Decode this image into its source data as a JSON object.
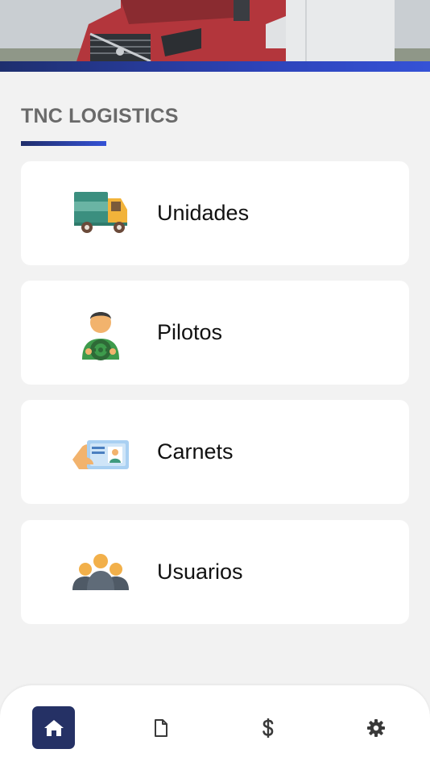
{
  "header": {
    "image": "truck-banner-image"
  },
  "section": {
    "title": "TNC LOGISTICS"
  },
  "menu": [
    {
      "label": "Unidades",
      "icon": "delivery-truck-icon"
    },
    {
      "label": "Pilotos",
      "icon": "driver-icon"
    },
    {
      "label": "Carnets",
      "icon": "id-card-icon"
    },
    {
      "label": "Usuarios",
      "icon": "users-group-icon"
    }
  ],
  "bottom_nav": [
    {
      "icon": "home-icon",
      "active": true
    },
    {
      "icon": "document-icon",
      "active": false
    },
    {
      "icon": "dollar-icon",
      "active": false
    },
    {
      "icon": "gear-icon",
      "active": false
    }
  ],
  "colors": {
    "accent": "#253165",
    "accent_bright": "#3552d6",
    "background": "#f2f2f2"
  }
}
